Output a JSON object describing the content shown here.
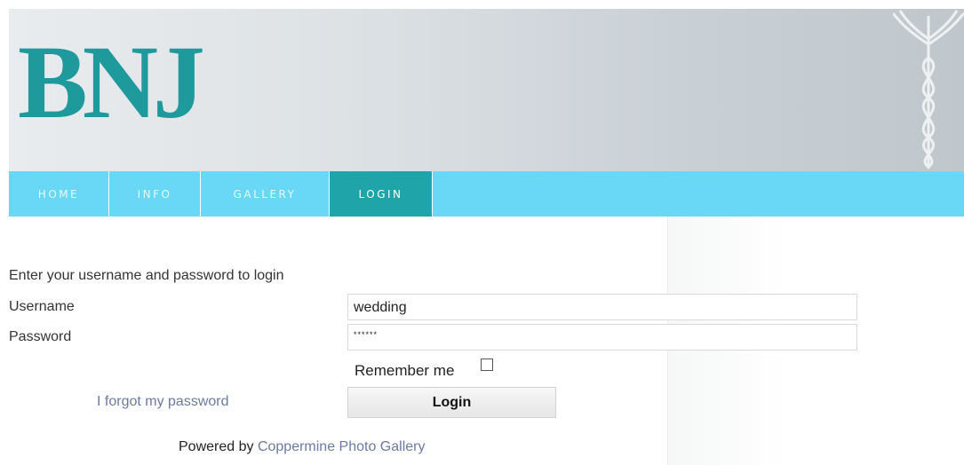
{
  "header": {
    "logo_text": "BNJ",
    "logo_color": "#1f9a9c"
  },
  "nav": {
    "items": [
      {
        "label": "HOME",
        "active": false
      },
      {
        "label": "INFO",
        "active": false
      },
      {
        "label": "GALLERY",
        "active": false
      },
      {
        "label": "LOGIN",
        "active": true
      }
    ],
    "bar_color": "#69d8f6",
    "active_color": "#1ea4a9"
  },
  "login": {
    "intro": "Enter your username and password to login",
    "username_label": "Username",
    "password_label": "Password",
    "username_value": "wedding",
    "password_value": "******",
    "remember_label": "Remember me",
    "remember_checked": false,
    "forgot_label": "I forgot my password",
    "submit_label": "Login"
  },
  "footer": {
    "powered_prefix": "Powered by ",
    "powered_link": "Coppermine Photo Gallery"
  },
  "icons": [
    "caduceus-icon",
    "checkbox"
  ]
}
